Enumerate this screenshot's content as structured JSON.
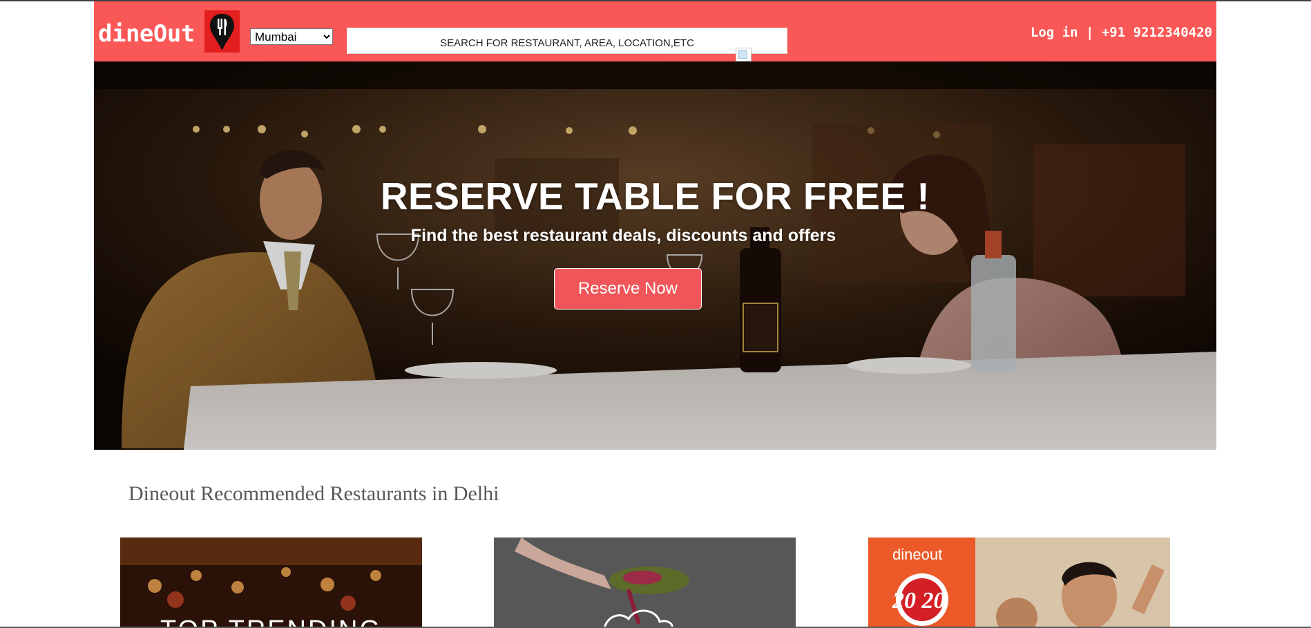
{
  "header": {
    "logo_text": "dineOut",
    "city_select": {
      "selected": "Mumbai",
      "options": [
        "Mumbai"
      ]
    },
    "search_placeholder": "SEARCH FOR RESTAURANT, AREA, LOCATION,ETC",
    "login_label": "Log in",
    "separator": " | ",
    "phone": "+91 9212340420"
  },
  "hero": {
    "title": "RESERVE TABLE FOR FREE !",
    "subtitle": "Find the best restaurant deals, discounts and offers",
    "cta_label": "Reserve Now"
  },
  "section": {
    "title": "Dineout Recommended Restaurants in Delhi"
  },
  "cards": [
    {
      "label": "TOP TRENDING"
    },
    {
      "label": ""
    },
    {
      "brand": "dineout",
      "badge": "20 20"
    }
  ],
  "colors": {
    "header_bg": "#fa5757",
    "logo_mark_bg": "#e31e1e",
    "cta_bg": "#f05659",
    "section_title": "#585858"
  },
  "icons": {
    "logo_mark": "map-pin-cutlery-icon",
    "broken_image": "broken-image-icon"
  }
}
